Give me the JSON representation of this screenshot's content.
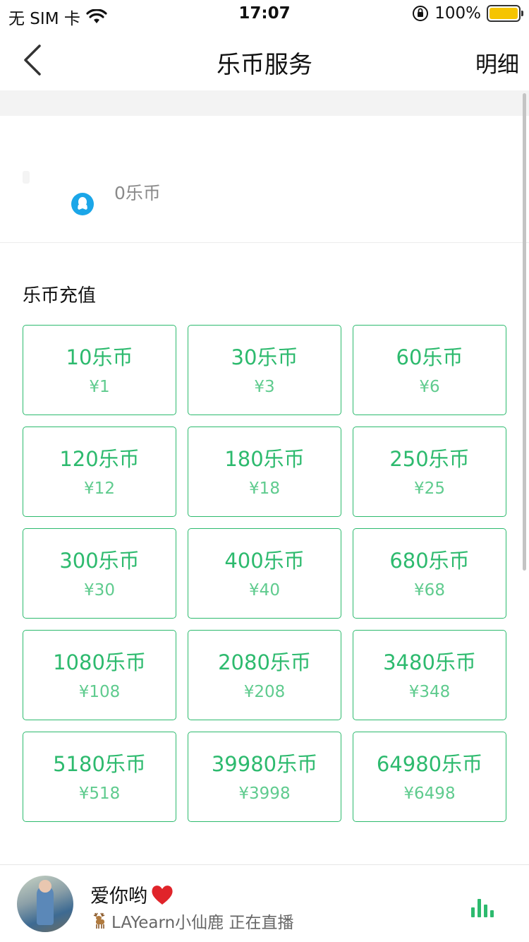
{
  "status": {
    "carrier": "无 SIM 卡",
    "time": "17:07",
    "battery": "100%"
  },
  "nav": {
    "title": "乐币服务",
    "detail": "明细"
  },
  "account": {
    "balance": "0乐币"
  },
  "recharge": {
    "title": "乐币充值",
    "options": [
      {
        "coins": "10乐币",
        "price": "¥1"
      },
      {
        "coins": "30乐币",
        "price": "¥3"
      },
      {
        "coins": "60乐币",
        "price": "¥6"
      },
      {
        "coins": "120乐币",
        "price": "¥12"
      },
      {
        "coins": "180乐币",
        "price": "¥18"
      },
      {
        "coins": "250乐币",
        "price": "¥25"
      },
      {
        "coins": "300乐币",
        "price": "¥30"
      },
      {
        "coins": "400乐币",
        "price": "¥40"
      },
      {
        "coins": "680乐币",
        "price": "¥68"
      },
      {
        "coins": "1080乐币",
        "price": "¥108"
      },
      {
        "coins": "2080乐币",
        "price": "¥208"
      },
      {
        "coins": "3480乐币",
        "price": "¥348"
      },
      {
        "coins": "5180乐币",
        "price": "¥518"
      },
      {
        "coins": "39980乐币",
        "price": "¥3998"
      },
      {
        "coins": "64980乐币",
        "price": "¥6498"
      }
    ]
  },
  "player": {
    "title": "爱你哟",
    "subtitle": "LAYearn小仙鹿 正在直播"
  },
  "colors": {
    "accent": "#2dba6e",
    "qq": "#1ba6e8",
    "battery": "#f5c400"
  }
}
